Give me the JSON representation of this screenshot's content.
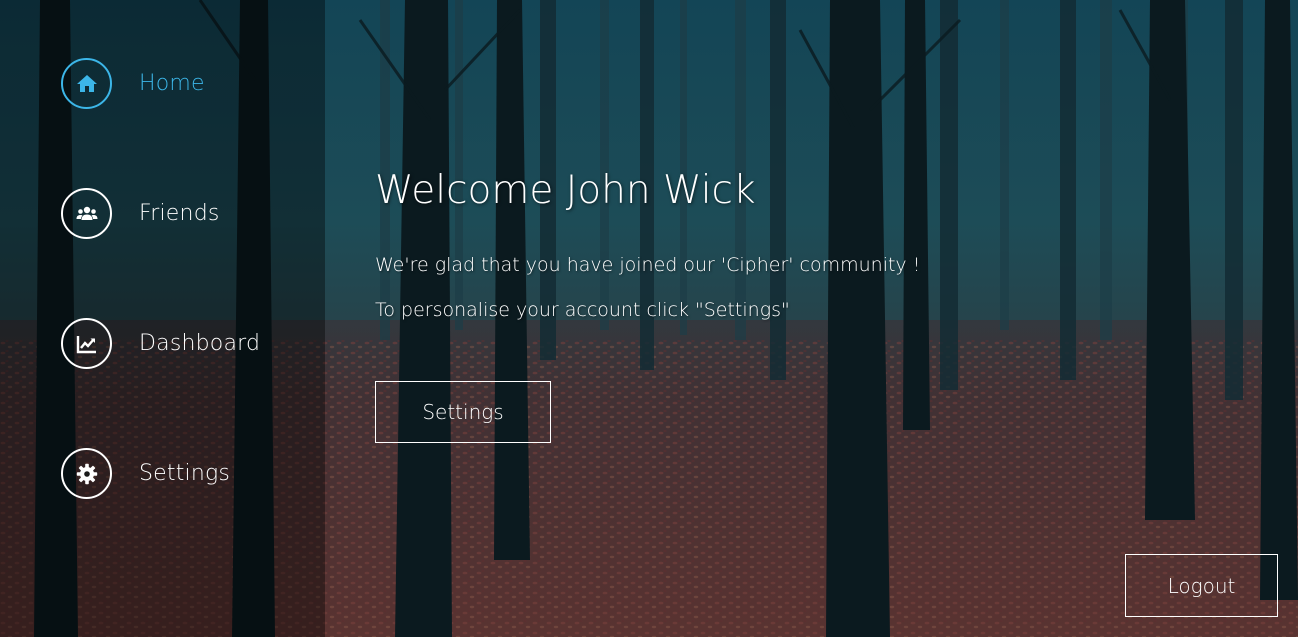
{
  "sidebar": {
    "items": [
      {
        "label": "Home",
        "icon": "home-icon",
        "active": true
      },
      {
        "label": "Friends",
        "icon": "users-icon",
        "active": false
      },
      {
        "label": "Dashboard",
        "icon": "chart-icon",
        "active": false
      },
      {
        "label": "Settings",
        "icon": "gear-icon",
        "active": false
      }
    ]
  },
  "main": {
    "welcome": "Welcome John Wick",
    "line1": "We're glad that you have joined our 'Cipher' community !",
    "line2": "To personalise your account click \"Settings\"",
    "settings_button": "Settings"
  },
  "logout_button": "Logout",
  "colors": {
    "accent": "#3cb6e8",
    "text": "#ffffff"
  }
}
